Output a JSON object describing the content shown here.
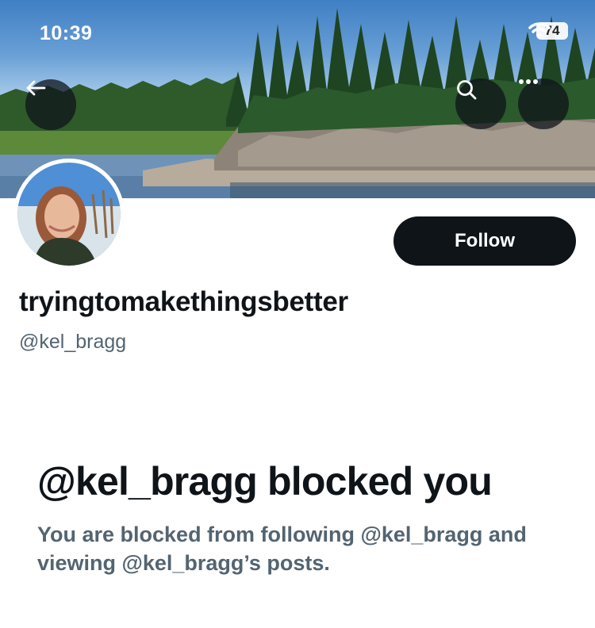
{
  "status_bar": {
    "time": "10:39",
    "battery": "74"
  },
  "header": {
    "icons": [
      "back-arrow-icon",
      "search-icon",
      "more-options-icon"
    ]
  },
  "profile": {
    "display_name": "tryingtomakethingsbetter",
    "handle": "@kel_bragg",
    "follow_label": "Follow"
  },
  "blocked": {
    "title": "@kel_bragg blocked you",
    "description": "You are blocked from following @kel_bragg and viewing @kel_bragg’s posts."
  },
  "colors": {
    "primary_text": "#0f1419",
    "secondary_text": "#536471",
    "follow_button_bg": "#0f1419",
    "follow_button_text": "#ffffff"
  }
}
